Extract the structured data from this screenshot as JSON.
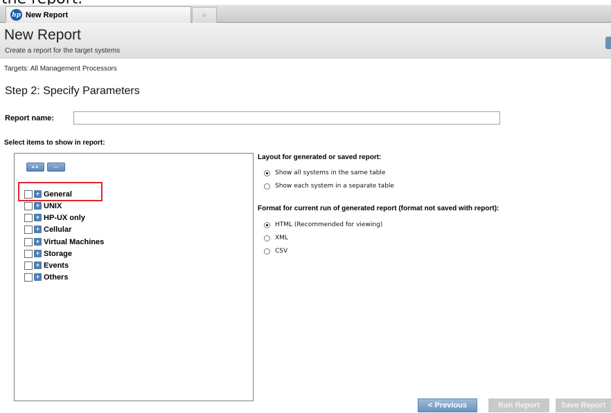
{
  "caption_fragment": "the report.",
  "tab": {
    "title": "New Report",
    "new_tab_symbol": "✧"
  },
  "header": {
    "title": "New Report",
    "subtitle": "Create a report for the target systems"
  },
  "targets": {
    "text": "Targets:  All Management Processors"
  },
  "step": {
    "title": "Step 2: Specify Parameters"
  },
  "report_name": {
    "label": "Report name:",
    "value": ""
  },
  "items_section": {
    "label": "Select items to show in report:",
    "expand_all_label": "++",
    "collapse_all_label": "--",
    "items": [
      {
        "label": "General",
        "checked": false,
        "highlighted": true
      },
      {
        "label": "UNIX",
        "checked": false
      },
      {
        "label": "HP-UX only",
        "checked": false
      },
      {
        "label": "Cellular",
        "checked": false
      },
      {
        "label": "Virtual Machines",
        "checked": false
      },
      {
        "label": "Storage",
        "checked": false
      },
      {
        "label": "Events",
        "checked": false
      },
      {
        "label": "Others",
        "checked": false
      }
    ]
  },
  "layout_section": {
    "title": "Layout for generated or saved report:",
    "options": [
      {
        "label": "Show all systems in the same table",
        "selected": true
      },
      {
        "label": "Show each system in a separate table",
        "selected": false
      }
    ]
  },
  "format_section": {
    "title": "Format for current run of generated report (format not saved with report):",
    "options": [
      {
        "label": "HTML (Recommended for viewing)",
        "selected": true
      },
      {
        "label": "XML",
        "selected": false
      },
      {
        "label": "CSV",
        "selected": false
      }
    ]
  },
  "footer": {
    "previous_label": "< Previous",
    "run_label": "Run Report",
    "save_label": "Save Report"
  },
  "colors": {
    "accent": "#5b87b8",
    "highlight_border": "#e0242b",
    "disabled_button": "#c9c9c9"
  }
}
